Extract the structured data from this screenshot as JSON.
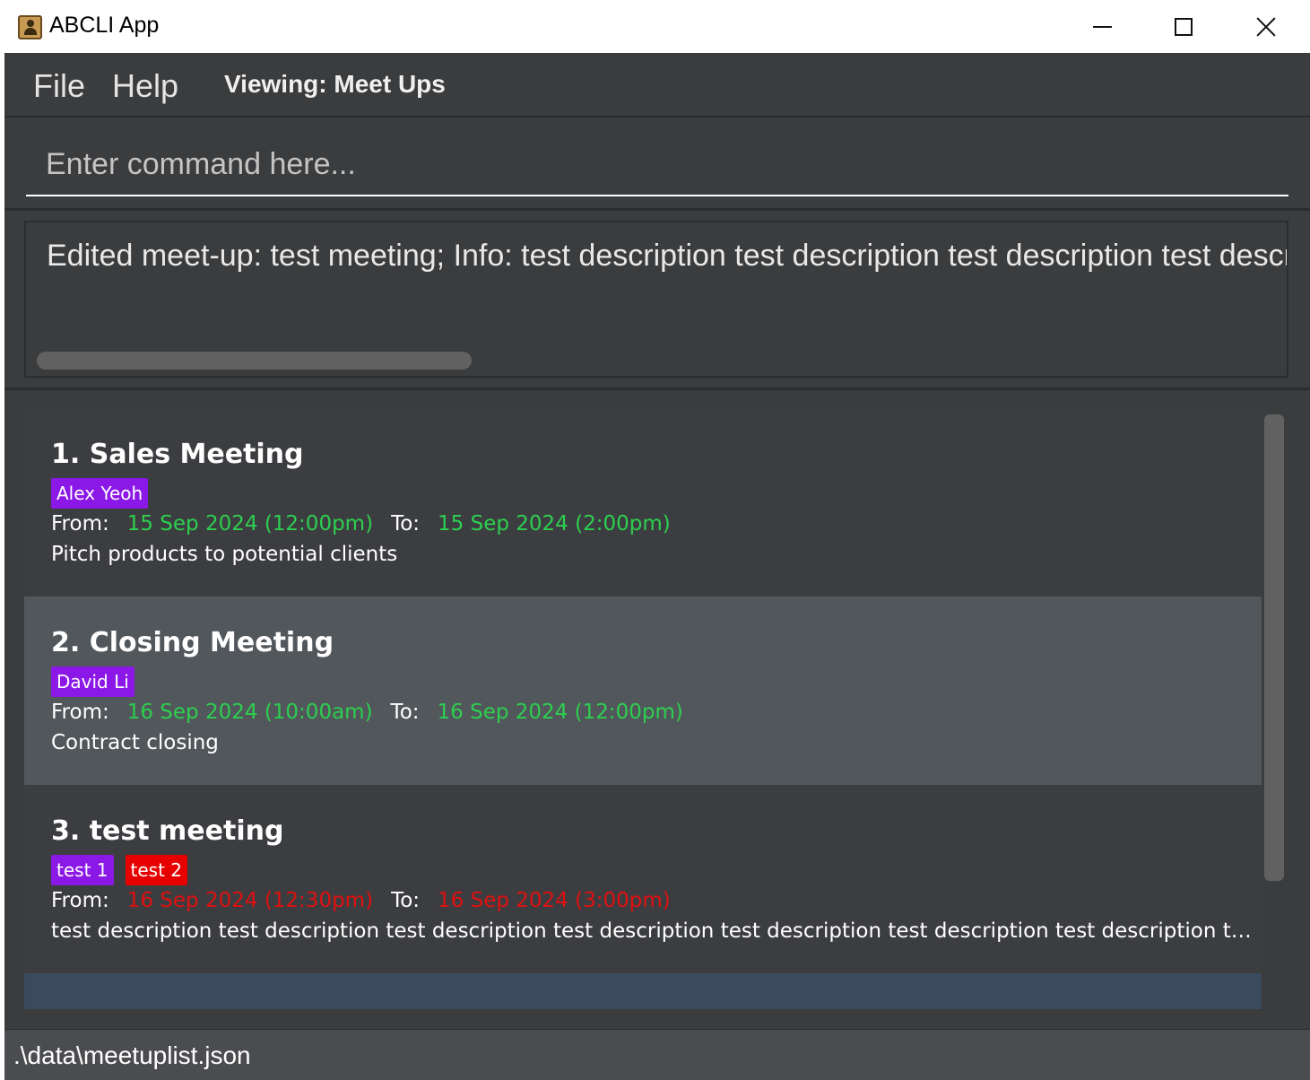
{
  "window": {
    "title": "ABCLI App"
  },
  "menu": {
    "file": "File",
    "help": "Help",
    "viewing": "Viewing: Meet Ups"
  },
  "command": {
    "placeholder": "Enter command here...",
    "value": ""
  },
  "result": {
    "text": "Edited meet-up: test meeting; Info: test description test description test description test descripti"
  },
  "meetups": [
    {
      "title": "1. Sales Meeting",
      "tags": [
        "Alex Yeoh"
      ],
      "from_label": "From:",
      "from": "15 Sep 2024 (12:00pm)",
      "to_label": "To:",
      "to": "15 Sep 2024 (2:00pm)",
      "description": "Pitch products to potential clients",
      "time_status": "ok"
    },
    {
      "title": "2. Closing Meeting",
      "tags": [
        "David Li"
      ],
      "from_label": "From:",
      "from": "16 Sep 2024 (10:00am)",
      "to_label": "To:",
      "to": "16 Sep 2024 (12:00pm)",
      "description": "Contract closing",
      "time_status": "ok"
    },
    {
      "title": "3. test meeting",
      "tags": [
        "test 1",
        "test 2"
      ],
      "from_label": "From:",
      "from": "16 Sep 2024 (12:30pm)",
      "to_label": "To:",
      "to": "16 Sep 2024 (3:00pm)",
      "description": "test description test description test description test description test description test description test description te...",
      "time_status": "conflict"
    }
  ],
  "status_bar": {
    "path": ".\\data\\meetuplist.json"
  },
  "colors": {
    "background": "#3b3c3e",
    "tag_purple": "#8b18e6",
    "tag_red": "#e60000",
    "time_ok": "#2dcf4f",
    "time_conflict": "#e01010",
    "selected_row": "#52575c"
  }
}
